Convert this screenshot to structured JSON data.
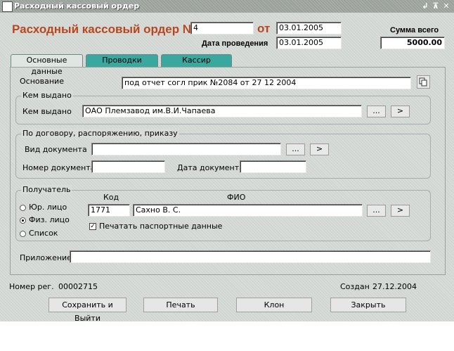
{
  "window": {
    "title": "Расходный кассовый ордер",
    "controls": [
      "↲",
      "⊼",
      "✕"
    ]
  },
  "header": {
    "title": "Расходный кассовый ордер №",
    "number": "4",
    "from_label": "от",
    "date": "03.01.2005",
    "posting_date_label": "Дата проведения",
    "posting_date": "03.01.2005",
    "total_label": "Сумма всего",
    "total": "5000.00"
  },
  "tabs": [
    {
      "label": "Основные данные",
      "active": true
    },
    {
      "label": "Проводки",
      "active": false
    },
    {
      "label": "Кассир",
      "active": false
    }
  ],
  "basis": {
    "label": "Основание",
    "value": "под отчет согл прик №2084 от 27 12 2004"
  },
  "issued": {
    "group_label": "Кем выдано",
    "label": "Кем выдано",
    "value": "ОАО Племзавод им.В.И.Чапаева"
  },
  "contract": {
    "group_label": "По договору, распоряжению, приказу",
    "doc_type_label": "Вид документа",
    "doc_type": "",
    "doc_number_label": "Номер документа",
    "doc_number": "",
    "doc_date_label": "Дата документа",
    "doc_date": ""
  },
  "recipient": {
    "group_label": "Получатель",
    "code_header": "Код",
    "fio_header": "ФИО",
    "code": "1771",
    "fio": "Сахно В. С.",
    "options": [
      {
        "label": "Юр. лицо",
        "selected": false
      },
      {
        "label": "Физ. лицо",
        "selected": true
      },
      {
        "label": "Список",
        "selected": false
      }
    ],
    "print_passport_label": "Печатать паспортные данные",
    "print_passport": true
  },
  "attachment": {
    "label": "Приложение",
    "value": ""
  },
  "footer": {
    "reg_label": "Номер рег.",
    "reg_number": "00002715",
    "created_label": "Создан",
    "created_date": "27.12.2004"
  },
  "buttons": {
    "ellipsis": "...",
    "arrow": ">",
    "save_exit": "Сохранить и Выйти",
    "print": "Печать",
    "clone": "Клон",
    "close": "Закрыть"
  }
}
